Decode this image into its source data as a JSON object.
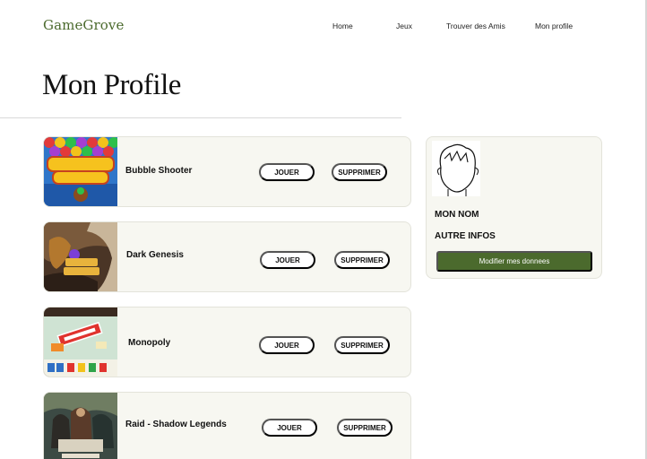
{
  "header": {
    "logo": "GameGrove",
    "nav": [
      "Home",
      "Jeux",
      "Trouver des  Amis",
      "Mon profile"
    ]
  },
  "page": {
    "title": "Mon Profile"
  },
  "games": [
    {
      "name": "Bubble Shooter",
      "play_label": "JOUER",
      "delete_label": "SUPPRIMER",
      "thumbnail": "bubble-shooter-artwork"
    },
    {
      "name": "Dark Genesis",
      "play_label": "JOUER",
      "delete_label": "SUPPRIMER",
      "thumbnail": "dark-genesis-artwork"
    },
    {
      "name": "Monopoly",
      "play_label": "JOUER",
      "delete_label": "SUPPRIMER",
      "thumbnail": "monopoly-board-artwork"
    },
    {
      "name": "Raid - Shadow Legends",
      "play_label": "JOUER",
      "delete_label": "SUPPRIMER",
      "thumbnail": "raid-shadow-legends-artwork"
    }
  ],
  "profile": {
    "avatar": "face-sketch-icon",
    "name": "MON NOM",
    "info": "AUTRE INFOS",
    "edit_label": "Modifier mes donnees"
  },
  "colors": {
    "brand_green": "#4b6a2d",
    "card_background": "#f7f7f1",
    "card_border": "#e3e3da"
  }
}
